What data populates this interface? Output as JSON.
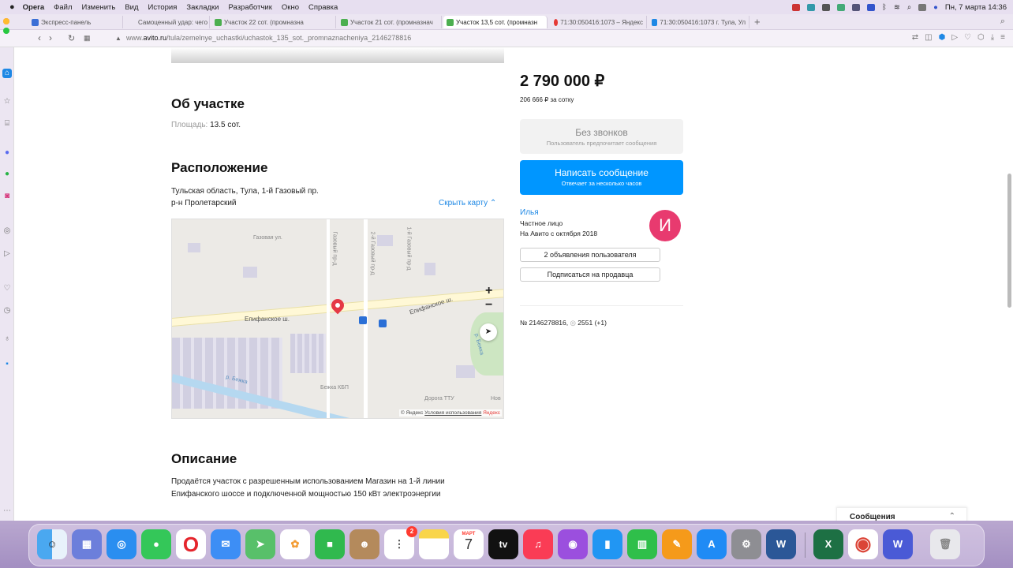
{
  "menubar": {
    "apple": "",
    "app": "Opera",
    "items": [
      "Файл",
      "Изменить",
      "Вид",
      "История",
      "Закладки",
      "Разработчик",
      "Окно",
      "Справка"
    ],
    "datetime": "Пн, 7 марта  14:36"
  },
  "tabs": [
    {
      "label": "Экспресс-панель",
      "color": "#3b6fd6"
    },
    {
      "label": "Самоценный удар: чего ждут",
      "color": "#e53935"
    },
    {
      "label": "Участок 22 сот. (промназна",
      "color": "#4caf50"
    },
    {
      "label": "Участок 21 сот. (промназнач",
      "color": "#4caf50"
    },
    {
      "label": "Участок 13,5 сот. (промназн",
      "color": "#4caf50",
      "active": true
    },
    {
      "label": "71:30:050416:1073 – Яндекс",
      "color": "#e53935"
    },
    {
      "label": "71:30:050416:1073 г. Тула, Ул",
      "color": "#1e88e5"
    }
  ],
  "address": {
    "prefix": "www.",
    "domain": "avito.ru",
    "path": "/tula/zemelnye_uchastki/uchastok_135_sot._promnaznacheniya_2146278816"
  },
  "about": {
    "title": "Об участке",
    "area_label": "Площадь:",
    "area_value": "13.5 сот."
  },
  "location": {
    "title": "Расположение",
    "address": "Тульская область, Тула, 1-й Газовый пр.",
    "district": "р-н Пролетарский",
    "hide_map": "Скрыть карту ⌃"
  },
  "map": {
    "labels": {
      "street1": "Газовая ул.",
      "street2": "Газовый пр-д",
      "street3": "2-й Газовый пр-д",
      "street4": "1-й Газовый пр-д",
      "road_left": "Епифанское ш.",
      "road_right": "Епифанское ш.",
      "river": "р. Бежка",
      "river2": "р. Бежка",
      "village": "Бежка КБП",
      "pond": "Дорога ТТУ",
      "misc": "Нов"
    },
    "zoom_in": "+",
    "zoom_out": "−",
    "copyright": "© Яндекс",
    "terms": "Условия использования",
    "brand": "Яндекс"
  },
  "description": {
    "title": "Описание",
    "line1": "Продаётся участок с разрешенным использованием Магазин на 1-й линии",
    "line2": "Епифанского шоссе и подключенной мощностью 150 кВт электроэнергии"
  },
  "sidebar_right": {
    "price": "2 790 000 ₽",
    "per_sotka": "206 666 ₽ за сотку",
    "nocall_title": "Без звонков",
    "nocall_sub": "Пользователь предпочитает сообщения",
    "msg_title": "Написать сообщение",
    "msg_sub": "Отвечает за несколько часов",
    "seller_name": "Илья",
    "seller_type": "Частное лицо",
    "seller_since": "На Авито с октября 2018",
    "avatar_letter": "И",
    "ads_button": "2 объявления пользователя",
    "subscribe_button": "Подписаться на продавца",
    "ad_number": "№ 2146278816,",
    "views": "2551 (+1)"
  },
  "messages_panel": {
    "title": "Сообщения",
    "chevron": "⌃"
  },
  "dock": {
    "calendar_month": "МАРТ",
    "calendar_day": "7",
    "reminders_badge": "2",
    "tv_label": "tv"
  },
  "colors": {
    "accent": "#0096ff",
    "link": "#1e88e5",
    "avatar": "#e83a6f",
    "pin": "#e53945"
  }
}
